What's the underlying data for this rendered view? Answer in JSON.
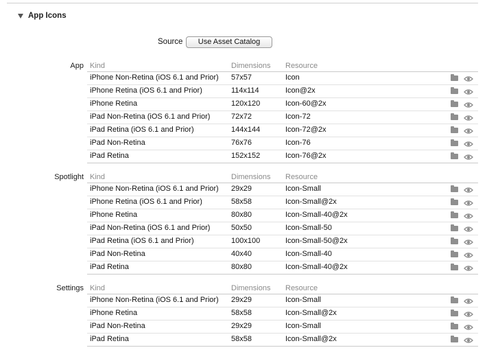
{
  "section": {
    "title": "App Icons"
  },
  "source": {
    "label": "Source",
    "button_label": "Use Asset Catalog"
  },
  "columns": {
    "kind": "Kind",
    "dimensions": "Dimensions",
    "resource": "Resource"
  },
  "groups": [
    {
      "label": "App",
      "rows": [
        {
          "kind": "iPhone Non-Retina (iOS 6.1 and Prior)",
          "dimensions": "57x57",
          "resource": "Icon"
        },
        {
          "kind": "iPhone Retina (iOS 6.1 and Prior)",
          "dimensions": "114x114",
          "resource": "Icon@2x"
        },
        {
          "kind": "iPhone Retina",
          "dimensions": "120x120",
          "resource": "Icon-60@2x"
        },
        {
          "kind": "iPad Non-Retina (iOS 6.1 and Prior)",
          "dimensions": "72x72",
          "resource": "Icon-72"
        },
        {
          "kind": "iPad Retina (iOS 6.1 and Prior)",
          "dimensions": "144x144",
          "resource": "Icon-72@2x"
        },
        {
          "kind": "iPad Non-Retina",
          "dimensions": "76x76",
          "resource": "Icon-76"
        },
        {
          "kind": "iPad Retina",
          "dimensions": "152x152",
          "resource": "Icon-76@2x"
        }
      ]
    },
    {
      "label": "Spotlight",
      "rows": [
        {
          "kind": "iPhone Non-Retina (iOS 6.1 and Prior)",
          "dimensions": "29x29",
          "resource": "Icon-Small"
        },
        {
          "kind": "iPhone Retina (iOS 6.1 and Prior)",
          "dimensions": "58x58",
          "resource": "Icon-Small@2x"
        },
        {
          "kind": "iPhone Retina",
          "dimensions": "80x80",
          "resource": "Icon-Small-40@2x"
        },
        {
          "kind": "iPad Non-Retina (iOS 6.1 and Prior)",
          "dimensions": "50x50",
          "resource": "Icon-Small-50"
        },
        {
          "kind": "iPad Retina (iOS 6.1 and Prior)",
          "dimensions": "100x100",
          "resource": "Icon-Small-50@2x"
        },
        {
          "kind": "iPad Non-Retina",
          "dimensions": "40x40",
          "resource": "Icon-Small-40"
        },
        {
          "kind": "iPad Retina",
          "dimensions": "80x80",
          "resource": "Icon-Small-40@2x"
        }
      ]
    },
    {
      "label": "Settings",
      "rows": [
        {
          "kind": "iPhone Non-Retina (iOS 6.1 and Prior)",
          "dimensions": "29x29",
          "resource": "Icon-Small"
        },
        {
          "kind": "iPhone Retina",
          "dimensions": "58x58",
          "resource": "Icon-Small@2x"
        },
        {
          "kind": "iPad Non-Retina",
          "dimensions": "29x29",
          "resource": "Icon-Small"
        },
        {
          "kind": "iPad Retina",
          "dimensions": "58x58",
          "resource": "Icon-Small@2x"
        }
      ]
    }
  ],
  "row_actions": [
    "folder-icon",
    "eye-icon"
  ]
}
